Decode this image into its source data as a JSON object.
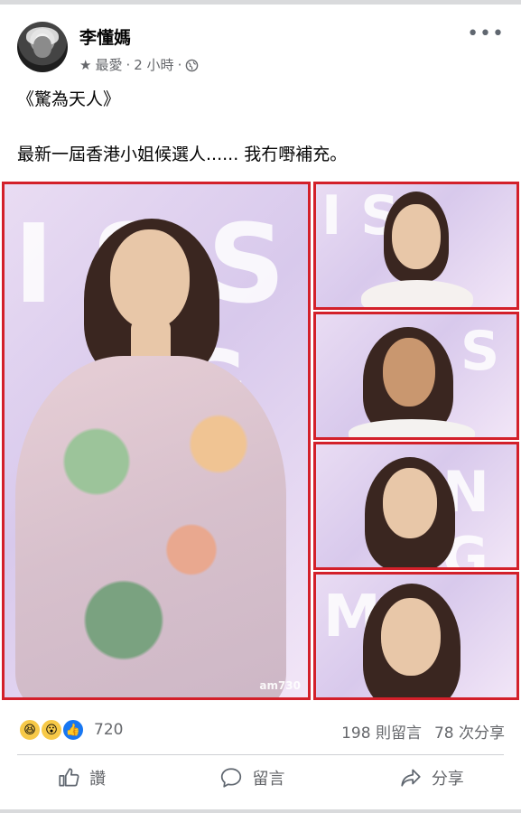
{
  "post": {
    "author": "李懂媽",
    "meta_label": "最愛",
    "time": "2 小時",
    "separator": "·",
    "more_label": "•••",
    "text_line1": "《驚為天人》",
    "text_line2": "最新一屆香港小姐候選人...... 我冇嘢補充。",
    "watermark": "am730"
  },
  "reactions": {
    "count": "720",
    "comments": "198 則留言",
    "shares": "78 次分享"
  },
  "actions": {
    "like": "讚",
    "comment": "留言",
    "share": "分享"
  },
  "colors": {
    "frame": "#d3202a",
    "like_blue": "#1877f2",
    "muted": "#65676b"
  }
}
